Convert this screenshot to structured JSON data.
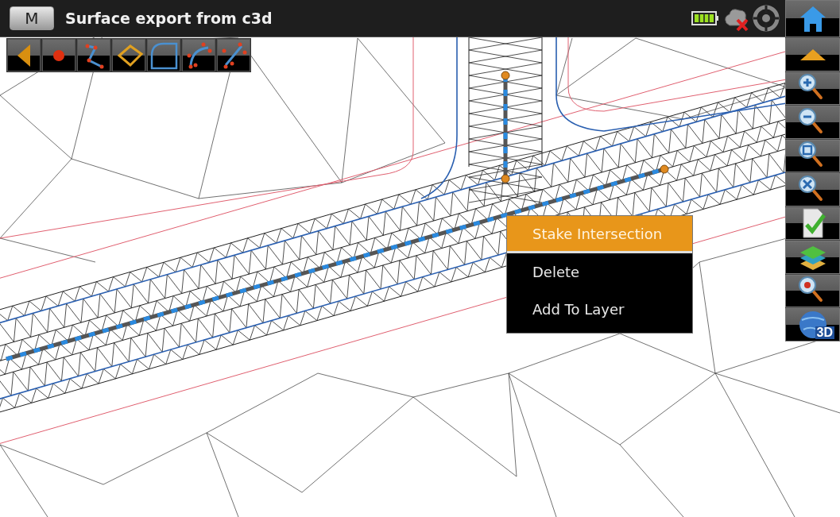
{
  "title_bar": {
    "menu_button": "M",
    "title": "Surface export from c3d"
  },
  "right_toolbar": {
    "view_3d_label": "3D"
  },
  "context_menu": {
    "items": [
      {
        "label": "Stake Intersection",
        "selected": true
      },
      {
        "label": "Delete",
        "selected": false
      },
      {
        "label": "Add To Layer",
        "selected": false
      }
    ]
  }
}
